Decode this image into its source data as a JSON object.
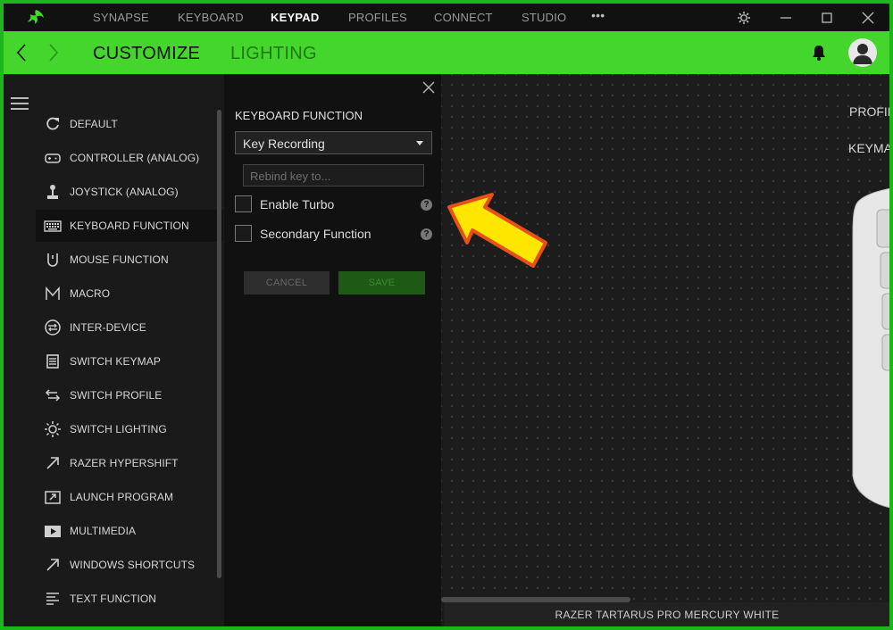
{
  "nav": {
    "items": [
      {
        "label": "SYNAPSE",
        "active": false
      },
      {
        "label": "KEYBOARD",
        "active": false
      },
      {
        "label": "KEYPAD",
        "active": true
      },
      {
        "label": "PROFILES",
        "active": false
      },
      {
        "label": "CONNECT",
        "active": false
      },
      {
        "label": "STUDIO",
        "active": false
      }
    ],
    "more": "•••"
  },
  "toolbar": {
    "tabs": [
      {
        "label": "CUSTOMIZE",
        "active": true
      },
      {
        "label": "LIGHTING",
        "active": false
      }
    ]
  },
  "sidebar": {
    "items": [
      {
        "label": "DEFAULT",
        "icon": "refresh-icon",
        "active": false
      },
      {
        "label": "CONTROLLER (ANALOG)",
        "icon": "gamepad-icon",
        "active": false
      },
      {
        "label": "JOYSTICK (ANALOG)",
        "icon": "joystick-icon",
        "active": false
      },
      {
        "label": "KEYBOARD FUNCTION",
        "icon": "keyboard-icon",
        "active": true
      },
      {
        "label": "MOUSE FUNCTION",
        "icon": "mouse-icon",
        "active": false
      },
      {
        "label": "MACRO",
        "icon": "macro-icon",
        "active": false
      },
      {
        "label": "INTER-DEVICE",
        "icon": "inter-device-icon",
        "active": false
      },
      {
        "label": "SWITCH KEYMAP",
        "icon": "keymap-icon",
        "active": false
      },
      {
        "label": "SWITCH PROFILE",
        "icon": "switch-arrows-icon",
        "active": false
      },
      {
        "label": "SWITCH LIGHTING",
        "icon": "sun-icon",
        "active": false
      },
      {
        "label": "RAZER HYPERSHIFT",
        "icon": "hypershift-arrow-icon",
        "active": false
      },
      {
        "label": "LAUNCH PROGRAM",
        "icon": "launch-icon",
        "active": false
      },
      {
        "label": "MULTIMEDIA",
        "icon": "play-icon",
        "active": false
      },
      {
        "label": "WINDOWS SHORTCUTS",
        "icon": "shortcut-arrow-icon",
        "active": false
      },
      {
        "label": "TEXT FUNCTION",
        "icon": "text-lines-icon",
        "active": false
      }
    ]
  },
  "panel": {
    "title": "KEYBOARD FUNCTION",
    "dropdown_value": "Key Recording",
    "rebind_placeholder": "Rebind key to...",
    "turbo_label": "Enable Turbo",
    "secondary_label": "Secondary Function",
    "help_glyph": "?",
    "cancel_label": "CANCEL",
    "save_label": "SAVE"
  },
  "main": {
    "profile_label": "PROFIL",
    "keymap_label": "KEYMA",
    "device_name": "RAZER TARTARUS PRO MERCURY WHITE"
  },
  "colors": {
    "accent": "#44d62c",
    "frame_border": "#1cb51c",
    "annotation_arrow": "#ffe600",
    "annotation_outline": "#e8501a"
  }
}
